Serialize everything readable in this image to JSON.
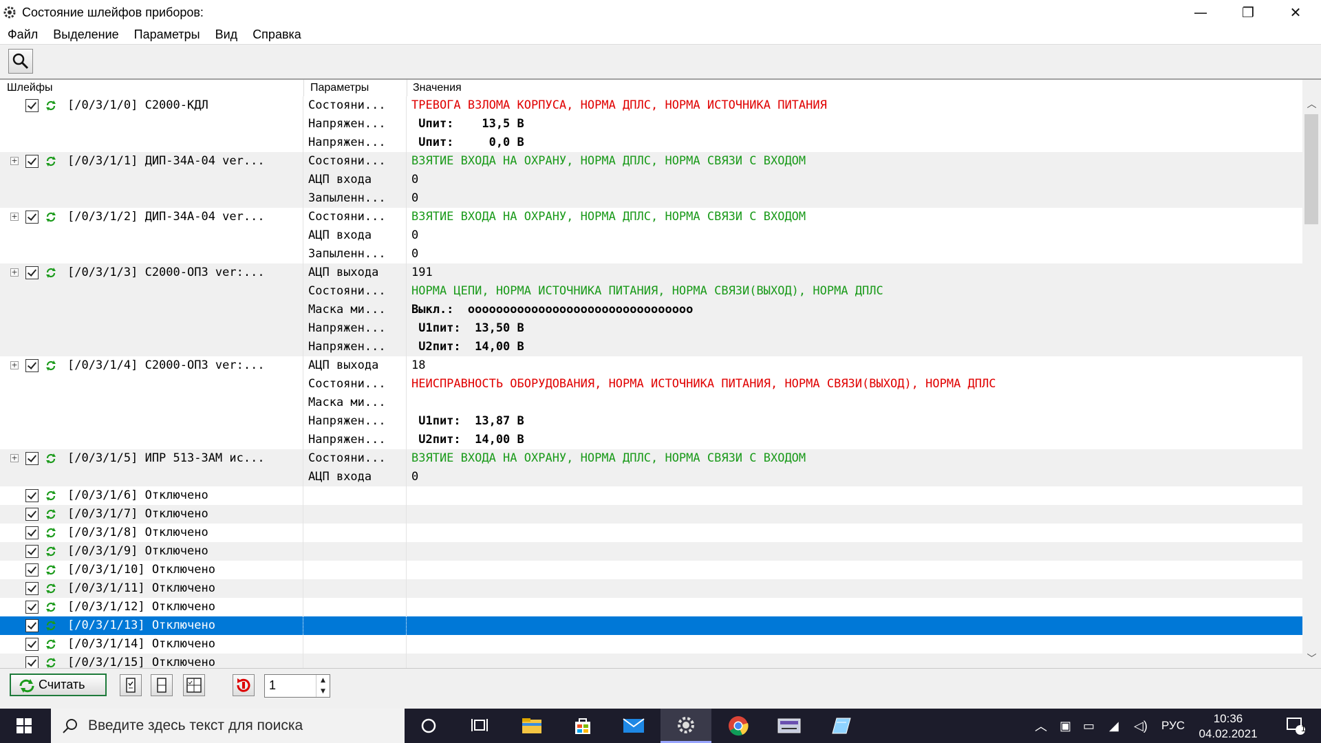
{
  "window": {
    "title": "Состояние шлейфов приборов:",
    "controls": {
      "minimize": "—",
      "restore": "❐",
      "close": "✕"
    }
  },
  "menu": [
    "Файл",
    "Выделение",
    "Параметры",
    "Вид",
    "Справка"
  ],
  "toolbar": {
    "search_icon": "search-icon"
  },
  "grid": {
    "headers": [
      "Шлейфы",
      "Параметры",
      "Значения"
    ],
    "rows": [
      {
        "loop": "[/0/3/1/0] С2000-КДЛ",
        "param": "Состояни...",
        "value": "ТРЕВОГА ВЗЛОМА КОРПУСА, НОРМА ДПЛС, НОРМА ИСТОЧНИКА ПИТАНИЯ",
        "color": "red",
        "expander": false,
        "checkbox": true,
        "alt": false
      },
      {
        "loop": "",
        "param": "Напряжен...",
        "value": " Uпит:    13,5 В",
        "color": "black",
        "alt": false
      },
      {
        "loop": "",
        "param": "Напряжен...",
        "value": " Uпит:     0,0 В",
        "color": "black",
        "alt": false
      },
      {
        "loop": "[/0/3/1/1] ДИП-34А-04 ver...",
        "param": "Состояни...",
        "value": "ВЗЯТИЕ ВХОДА НА ОХРАНУ, НОРМА ДПЛС, НОРМА СВЯЗИ С ВХОДОМ",
        "color": "green",
        "expander": true,
        "checkbox": true,
        "alt": true
      },
      {
        "loop": "",
        "param": "АЦП входа",
        "value": "0",
        "color": "black",
        "alt": true
      },
      {
        "loop": "",
        "param": "Запыленн...",
        "value": "0",
        "color": "black",
        "alt": true
      },
      {
        "loop": "[/0/3/1/2] ДИП-34А-04 ver...",
        "param": "Состояни...",
        "value": "ВЗЯТИЕ ВХОДА НА ОХРАНУ, НОРМА ДПЛС, НОРМА СВЯЗИ С ВХОДОМ",
        "color": "green",
        "expander": true,
        "checkbox": true,
        "alt": false
      },
      {
        "loop": "",
        "param": "АЦП входа",
        "value": "0",
        "color": "black",
        "alt": false
      },
      {
        "loop": "",
        "param": "Запыленн...",
        "value": "0",
        "color": "black",
        "alt": false
      },
      {
        "loop": "[/0/3/1/3] С2000-ОПЗ ver:...",
        "param": "АЦП выхода",
        "value": "191",
        "color": "black",
        "expander": true,
        "checkbox": true,
        "alt": true
      },
      {
        "loop": "",
        "param": "Состояни...",
        "value": "НОРМА ЦЕПИ, НОРМА ИСТОЧНИКА ПИТАНИЯ, НОРМА СВЯЗИ(ВЫХОД), НОРМА ДПЛС",
        "color": "green",
        "alt": true
      },
      {
        "loop": "",
        "param": "Маска ми...",
        "value": "Выкл.:  oooooooooooooooooooooooooooooooo",
        "color": "black",
        "alt": true
      },
      {
        "loop": "",
        "param": "Напряжен...",
        "value": " U1пит:  13,50 В",
        "color": "black",
        "alt": true
      },
      {
        "loop": "",
        "param": "Напряжен...",
        "value": " U2пит:  14,00 В",
        "color": "black",
        "alt": true
      },
      {
        "loop": "[/0/3/1/4] С2000-ОПЗ ver:...",
        "param": "АЦП выхода",
        "value": "18",
        "color": "black",
        "expander": true,
        "checkbox": true,
        "alt": false
      },
      {
        "loop": "",
        "param": "Состояни...",
        "value": "НЕИСПРАВНОСТЬ ОБОРУДОВАНИЯ, НОРМА ИСТОЧНИКА ПИТАНИЯ, НОРМА СВЯЗИ(ВЫХОД), НОРМА ДПЛС",
        "color": "red",
        "alt": false
      },
      {
        "loop": "",
        "param": "Маска ми...",
        "value": "",
        "color": "black",
        "alt": false
      },
      {
        "loop": "",
        "param": "Напряжен...",
        "value": " U1пит:  13,87 В",
        "color": "black",
        "alt": false
      },
      {
        "loop": "",
        "param": "Напряжен...",
        "value": " U2пит:  14,00 В",
        "color": "black",
        "alt": false
      },
      {
        "loop": "[/0/3/1/5] ИПР 513-3АМ ис...",
        "param": "Состояни...",
        "value": "ВЗЯТИЕ ВХОДА НА ОХРАНУ, НОРМА ДПЛС, НОРМА СВЯЗИ С ВХОДОМ",
        "color": "green",
        "expander": true,
        "checkbox": true,
        "alt": true
      },
      {
        "loop": "",
        "param": "АЦП входа",
        "value": "0",
        "color": "black",
        "alt": true
      },
      {
        "loop": "[/0/3/1/6] Отключено",
        "param": "",
        "value": "",
        "color": "black",
        "checkbox": true,
        "alt": false
      },
      {
        "loop": "[/0/3/1/7] Отключено",
        "param": "",
        "value": "",
        "color": "black",
        "checkbox": true,
        "alt": true
      },
      {
        "loop": "[/0/3/1/8] Отключено",
        "param": "",
        "value": "",
        "color": "black",
        "checkbox": true,
        "alt": false
      },
      {
        "loop": "[/0/3/1/9] Отключено",
        "param": "",
        "value": "",
        "color": "black",
        "checkbox": true,
        "alt": true
      },
      {
        "loop": "[/0/3/1/10] Отключено",
        "param": "",
        "value": "",
        "color": "black",
        "checkbox": true,
        "alt": false
      },
      {
        "loop": "[/0/3/1/11] Отключено",
        "param": "",
        "value": "",
        "color": "black",
        "checkbox": true,
        "alt": true
      },
      {
        "loop": "[/0/3/1/12] Отключено",
        "param": "",
        "value": "",
        "color": "black",
        "checkbox": true,
        "alt": false
      },
      {
        "loop": "[/0/3/1/13] Отключено",
        "param": "",
        "value": "",
        "color": "black",
        "checkbox": true,
        "selected": true
      },
      {
        "loop": "[/0/3/1/14] Отключено",
        "param": "",
        "value": "",
        "color": "black",
        "checkbox": true,
        "alt": false
      },
      {
        "loop": "[/0/3/1/15] Отключено",
        "param": "",
        "value": "",
        "color": "black",
        "checkbox": true,
        "alt": true
      }
    ]
  },
  "bottombar": {
    "read_label": "Считать",
    "interval_value": "1"
  },
  "taskbar": {
    "search_placeholder": "Введите здесь текст для поиска",
    "lang": "РУС",
    "time": "10:36",
    "date": "04.02.2021",
    "notifications": "1"
  },
  "colors": {
    "red": "#e00000",
    "green": "#1a9a1a",
    "selection": "#0078d7",
    "taskbar": "#1c1c2b"
  }
}
